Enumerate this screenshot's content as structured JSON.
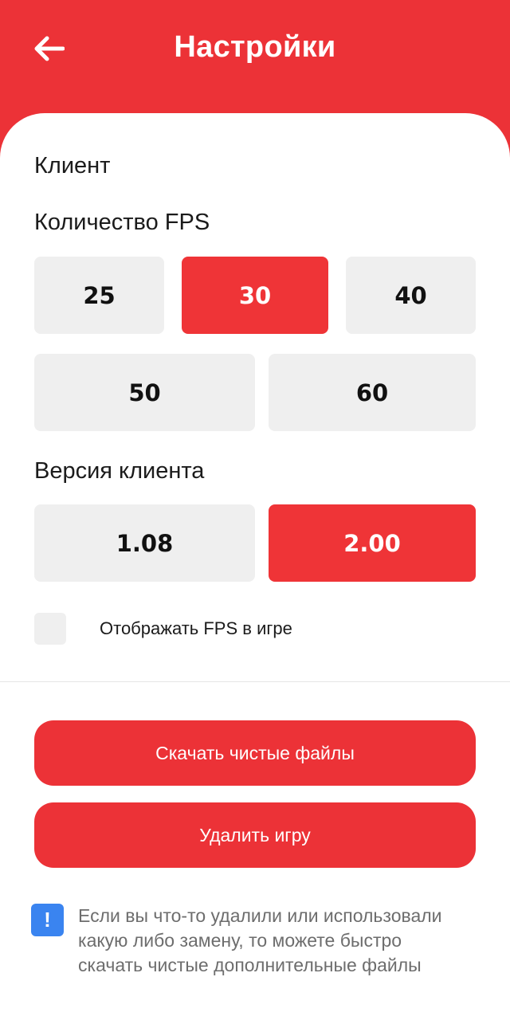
{
  "header": {
    "title": "Настройки",
    "back_icon": "arrow-left-icon",
    "background_color": "#ec3237"
  },
  "client": {
    "section_title": "Клиент",
    "fps": {
      "label": "Количество FPS",
      "options": [
        "25",
        "30",
        "40",
        "50",
        "60"
      ],
      "selected": "30"
    },
    "version": {
      "label": "Версия клиента",
      "options": [
        "1.08",
        "2.00"
      ],
      "selected": "2.00"
    },
    "show_fps": {
      "label": "Отображать FPS в игре",
      "checked": false
    }
  },
  "actions": {
    "download_clean_files": "Скачать чистые файлы",
    "delete_game": "Удалить игру"
  },
  "notice": {
    "icon": "exclamation-icon",
    "icon_glyph": "!",
    "text": "Если вы что-то удалили или использовали какую либо замену, то можете быстро скачать чистые дополнительные файлы"
  },
  "colors": {
    "accent": "#ec3237",
    "option_bg": "#efefef",
    "info_icon": "#3a84f0"
  }
}
